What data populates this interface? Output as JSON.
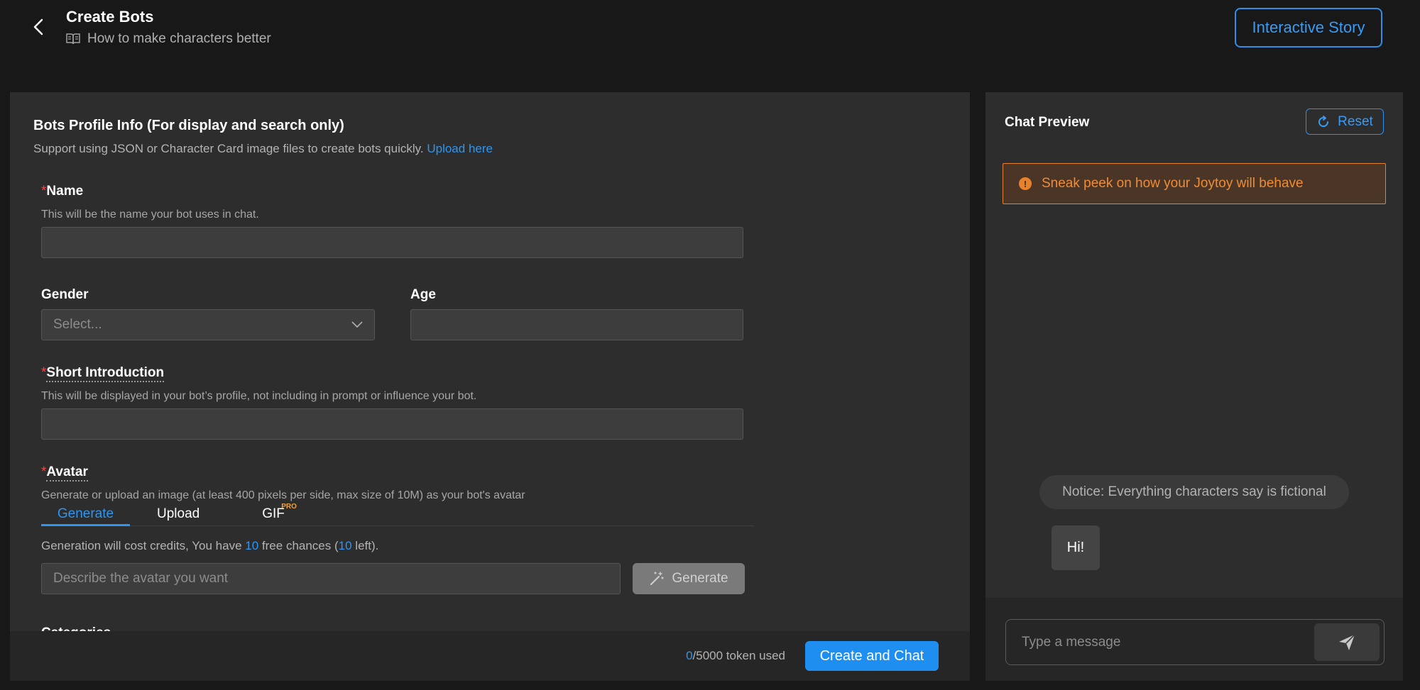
{
  "header": {
    "title": "Create Bots",
    "guide_link": "How to make characters better",
    "interactive_story_label": "Interactive Story"
  },
  "form": {
    "section_title": "Bots Profile Info (For display and search only)",
    "section_sub": "Support using JSON or Character Card image files to create bots quickly.",
    "upload_link": "Upload here",
    "name": {
      "required_mark": "*",
      "label": "Name",
      "help": "This will be the name your bot uses in chat.",
      "value": ""
    },
    "gender": {
      "label": "Gender",
      "placeholder": "Select..."
    },
    "age": {
      "label": "Age",
      "value": ""
    },
    "short_intro": {
      "required_mark": "*",
      "label": "Short Introduction",
      "help": "This will be displayed in your bot’s profile, not including in prompt or influence your bot.",
      "value": ""
    },
    "avatar": {
      "required_mark": "*",
      "label": "Avatar",
      "help": "Generate or upload an image (at least 400 pixels per side, max size of 10M) as your bot's avatar",
      "tabs": [
        "Generate",
        "Upload",
        "GIF"
      ],
      "active_tab": "Generate",
      "pro_badge": "PRO",
      "credits_prefix": "Generation will cost credits, You have ",
      "credits_free": "10",
      "credits_mid": " free chances (",
      "credits_left": "10",
      "credits_suffix": " left).",
      "prompt_placeholder": "Describe the avatar you want",
      "generate_label": "Generate"
    },
    "next_section_label": "Categories"
  },
  "footer": {
    "tokens_used": "0",
    "tokens_total": "/5000 token used",
    "create_label": "Create and Chat"
  },
  "chat": {
    "title": "Chat Preview",
    "reset_label": "Reset",
    "warning": "Sneak peek on how your Joytoy will behave",
    "warning_icon": "info-icon",
    "notice": "Notice: Everything characters say is fictional",
    "greeting": "Hi!",
    "input_placeholder": "Type a message"
  },
  "colors": {
    "accent": "#1f8ef1",
    "warning": "#e8822a",
    "required": "#e84a4a",
    "panel": "#2d2d2d",
    "background": "#181818"
  }
}
